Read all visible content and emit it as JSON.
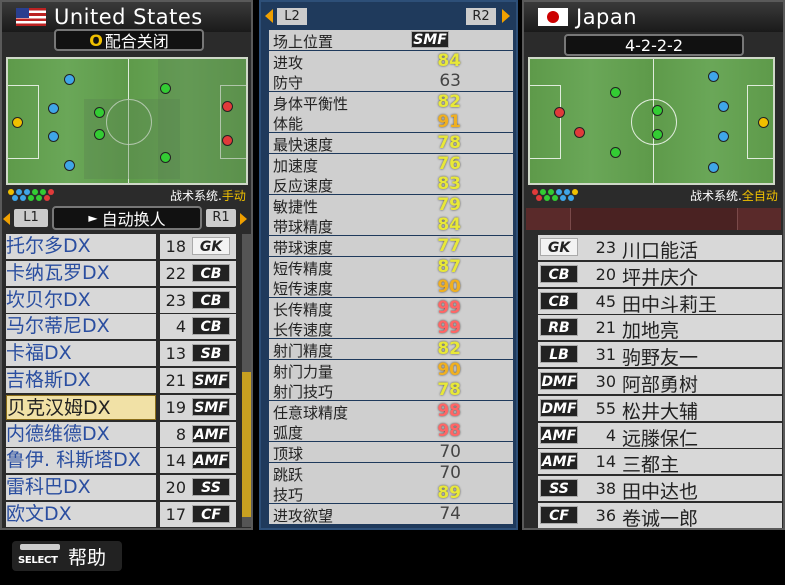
{
  "left_team": {
    "name": "United States",
    "coop_label": "配合关闭",
    "coop_prefix": "O",
    "tactics_label": "战术系统.",
    "tactics_mode": "手动",
    "sub_label": "自动换人",
    "tab_l1": "L1",
    "tab_r1": "R1",
    "players": [
      {
        "name": "托尔多DX",
        "number": "18",
        "position": "GK"
      },
      {
        "name": "卡纳瓦罗DX",
        "number": "22",
        "position": "CB"
      },
      {
        "name": "坎贝尔DX",
        "number": "23",
        "position": "CB"
      },
      {
        "name": "马尔蒂尼DX",
        "number": "4",
        "position": "CB"
      },
      {
        "name": "卡福DX",
        "number": "13",
        "position": "SB"
      },
      {
        "name": "吉格斯DX",
        "number": "21",
        "position": "SMF"
      },
      {
        "name": "贝克汉姆DX",
        "number": "19",
        "position": "SMF"
      },
      {
        "name": "内德维德DX",
        "number": "8",
        "position": "AMF"
      },
      {
        "name": "鲁伊. 科斯塔DX",
        "number": "14",
        "position": "AMF"
      },
      {
        "name": "雷科巴DX",
        "number": "20",
        "position": "SS"
      },
      {
        "name": "欧文DX",
        "number": "17",
        "position": "CF"
      }
    ]
  },
  "middle": {
    "tab_l2": "L2",
    "tab_r2": "R2",
    "stats": [
      {
        "label": "场上位置",
        "value": "SMF",
        "style": "badge"
      },
      {
        "label": "进攻",
        "value": "84",
        "style": "y"
      },
      {
        "label": "防守",
        "value": "63",
        "style": "g"
      },
      {
        "label": "身体平衡性",
        "value": "82",
        "style": "y"
      },
      {
        "label": "体能",
        "value": "91",
        "style": "o"
      },
      {
        "label": "最快速度",
        "value": "78",
        "style": "y"
      },
      {
        "label": "加速度",
        "value": "76",
        "style": "y"
      },
      {
        "label": "反应速度",
        "value": "83",
        "style": "y"
      },
      {
        "label": "敏捷性",
        "value": "79",
        "style": "y"
      },
      {
        "label": "带球精度",
        "value": "84",
        "style": "y"
      },
      {
        "label": "带球速度",
        "value": "77",
        "style": "y"
      },
      {
        "label": "短传精度",
        "value": "87",
        "style": "y"
      },
      {
        "label": "短传速度",
        "value": "90",
        "style": "o"
      },
      {
        "label": "长传精度",
        "value": "99",
        "style": "r"
      },
      {
        "label": "长传速度",
        "value": "99",
        "style": "r"
      },
      {
        "label": "射门精度",
        "value": "82",
        "style": "y"
      },
      {
        "label": "射门力量",
        "value": "90",
        "style": "o"
      },
      {
        "label": "射门技巧",
        "value": "78",
        "style": "y"
      },
      {
        "label": "任意球精度",
        "value": "98",
        "style": "r"
      },
      {
        "label": "弧度",
        "value": "98",
        "style": "r"
      },
      {
        "label": "顶球",
        "value": "70",
        "style": "g"
      },
      {
        "label": "跳跃",
        "value": "70",
        "style": "g"
      },
      {
        "label": "技巧",
        "value": "89",
        "style": "y"
      },
      {
        "label": "进攻欲望",
        "value": "74",
        "style": "g"
      }
    ]
  },
  "right_team": {
    "name": "Japan",
    "formation": "4-2-2-2",
    "tactics_label": "战术系统.",
    "tactics_mode": "全自动",
    "players": [
      {
        "name": "川口能活",
        "number": "23",
        "position": "GK"
      },
      {
        "name": "坪井庆介",
        "number": "20",
        "position": "CB"
      },
      {
        "name": "田中斗莉王",
        "number": "45",
        "position": "CB"
      },
      {
        "name": "加地亮",
        "number": "21",
        "position": "RB"
      },
      {
        "name": "驹野友一",
        "number": "31",
        "position": "LB"
      },
      {
        "name": "阿部勇树",
        "number": "30",
        "position": "DMF"
      },
      {
        "name": "松井大辅",
        "number": "55",
        "position": "DMF"
      },
      {
        "name": "远滕保仁",
        "number": "4",
        "position": "AMF"
      },
      {
        "name": "三都主",
        "number": "14",
        "position": "AMF"
      },
      {
        "name": "田中达也",
        "number": "38",
        "position": "SS"
      },
      {
        "name": "卷诚一郎",
        "number": "36",
        "position": "CF"
      }
    ]
  },
  "footer": {
    "select_label": "SELECT",
    "help_label": "帮助"
  },
  "colors": {
    "us_blue": "#3fa6e8",
    "green": "#33cc33",
    "red": "#e03a3a",
    "yellow": "#f0c000"
  }
}
